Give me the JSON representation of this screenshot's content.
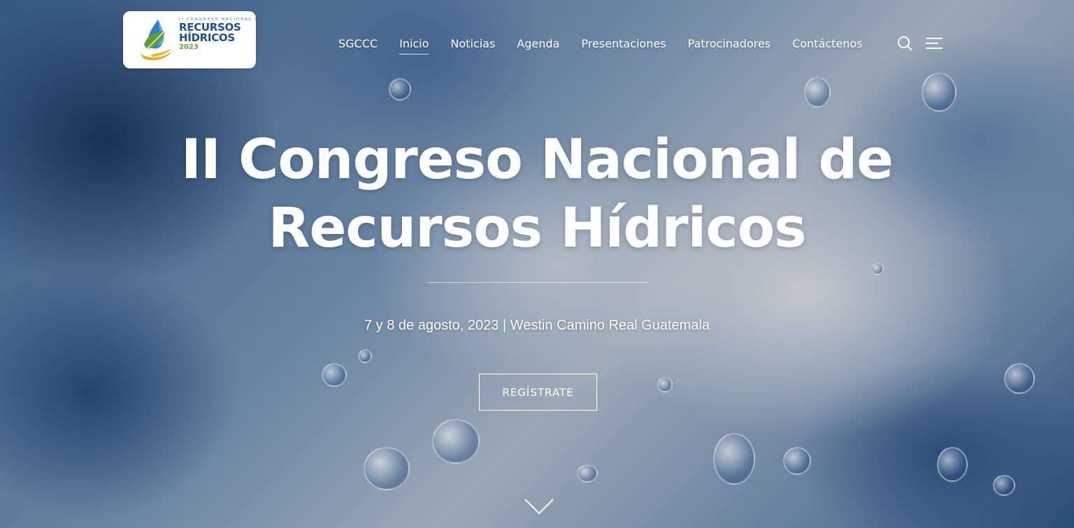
{
  "logo": {
    "line_small": "II CONGRESO NACIONAL DE",
    "line1": "RECURSOS",
    "line2": "HÍDRICOS",
    "year": "2023"
  },
  "nav": {
    "items": [
      {
        "label": "SGCCC",
        "active": false
      },
      {
        "label": "Inicio",
        "active": true
      },
      {
        "label": "Noticias",
        "active": false
      },
      {
        "label": "Agenda",
        "active": false
      },
      {
        "label": "Presentaciones",
        "active": false
      },
      {
        "label": "Patrocinadores",
        "active": false
      },
      {
        "label": "Contáctenos",
        "active": false
      }
    ],
    "search_icon": "search-icon",
    "menu_icon": "hamburger-menu-icon"
  },
  "hero": {
    "title_line1": "II Congreso Nacional de",
    "title_line2": "Recursos Hídricos",
    "subtitle": "7 y 8 de agosto, 2023 | Westin Camino Real Guatemala",
    "cta_label": "REGÍSTRATE",
    "scroll_icon": "chevron-down-icon"
  },
  "colors": {
    "logo_blue": "#1d4f94",
    "logo_green": "#6aa334",
    "logo_orange": "#f0a21b",
    "text": "#ffffff"
  }
}
